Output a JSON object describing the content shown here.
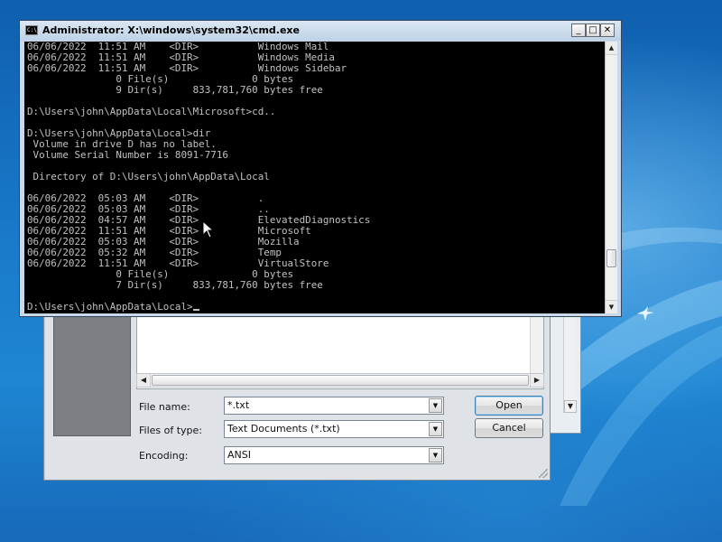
{
  "desktop": {
    "wallpaper": "windows-7-default-blue",
    "accent_color": "#1b74c4"
  },
  "save_dialog": {
    "file_name_label": "File name:",
    "file_name_value": "*.txt",
    "file_type_label": "Files of type:",
    "file_type_value": "Text Documents (*.txt)",
    "encoding_label": "Encoding:",
    "encoding_value": "ANSI",
    "open_label": "Open",
    "cancel_label": "Cancel"
  },
  "cmd": {
    "title": "Administrator: X:\\windows\\system32\\cmd.exe",
    "icon": "console-icon",
    "buttons": {
      "minimize": "minimize-icon",
      "maximize": "maximize-icon",
      "close": "close-icon"
    },
    "output": "06/06/2022  11:51 AM    <DIR>          Windows Mail\n06/06/2022  11:51 AM    <DIR>          Windows Media\n06/06/2022  11:51 AM    <DIR>          Windows Sidebar\n               0 File(s)              0 bytes\n               9 Dir(s)     833,781,760 bytes free\n\nD:\\Users\\john\\AppData\\Local\\Microsoft>cd..\n\nD:\\Users\\john\\AppData\\Local>dir\n Volume in drive D has no label.\n Volume Serial Number is 8091-7716\n\n Directory of D:\\Users\\john\\AppData\\Local\n\n06/06/2022  05:03 AM    <DIR>          .\n06/06/2022  05:03 AM    <DIR>          ..\n06/06/2022  04:57 AM    <DIR>          ElevatedDiagnostics\n06/06/2022  11:51 AM    <DIR>          Microsoft\n06/06/2022  05:03 AM    <DIR>          Mozilla\n06/06/2022  05:32 AM    <DIR>          Temp\n06/06/2022  11:51 AM    <DIR>          VirtualStore\n               0 File(s)              0 bytes\n               7 Dir(s)     833,781,760 bytes free\n\n",
    "prompt": "D:\\Users\\john\\AppData\\Local>"
  }
}
